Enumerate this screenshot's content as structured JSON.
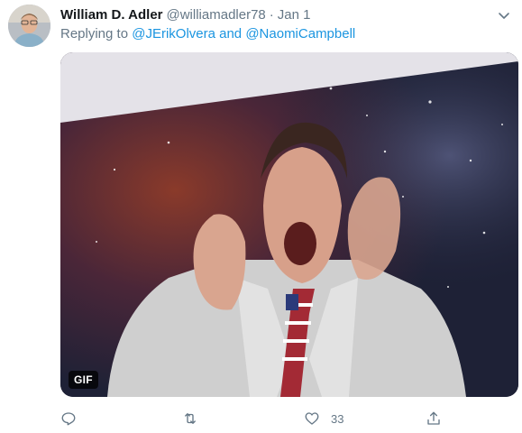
{
  "tweet": {
    "author_name": "William D. Adler",
    "handle": "@williamadler78",
    "separator": "·",
    "date": "Jan 1",
    "replying_prefix": "Replying to",
    "replying_to": "@JErikOlvera and @NaomiCampbell"
  },
  "media": {
    "badge": "GIF"
  },
  "actions": {
    "like_count": "33"
  },
  "colors": {
    "link": "#1b95e0",
    "secondary_text": "#657786"
  },
  "icons": [
    "chevron-down-icon",
    "reply-icon",
    "retweet-icon",
    "like-icon",
    "share-icon"
  ]
}
